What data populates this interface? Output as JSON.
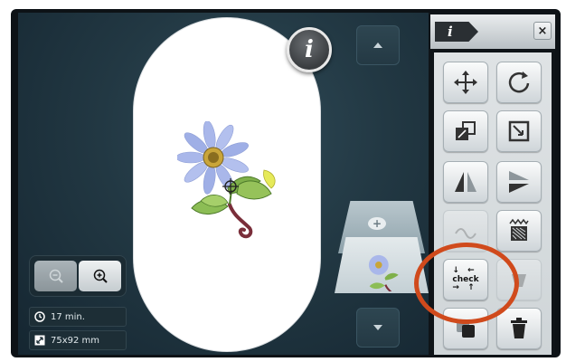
{
  "canvas": {
    "info_badge": "i"
  },
  "status": {
    "time": "17 min.",
    "size": "75x92 mm"
  },
  "panel": {
    "tab_label": "i",
    "close_label": "×",
    "check_button_label": "check"
  },
  "colors": {
    "annotation_circle": "#d04a1c",
    "hoop": "#ffffff",
    "screen_background": "#223843"
  },
  "icons": {
    "zoom_out": "zoom-out-icon",
    "zoom_in": "zoom-in-icon",
    "time": "clock-icon",
    "size": "resize-icon",
    "move": "move-icon",
    "rotate": "rotate-icon",
    "resize_proportional": "resize-proportional-icon",
    "resize": "resize-icon",
    "mirror_vertical": "mirror-left-right-icon",
    "mirror_horizontal": "mirror-up-down-icon",
    "stitch_density": "stitch-density-icon",
    "duplicate": "duplicate-icon",
    "delete": "trash-icon"
  }
}
